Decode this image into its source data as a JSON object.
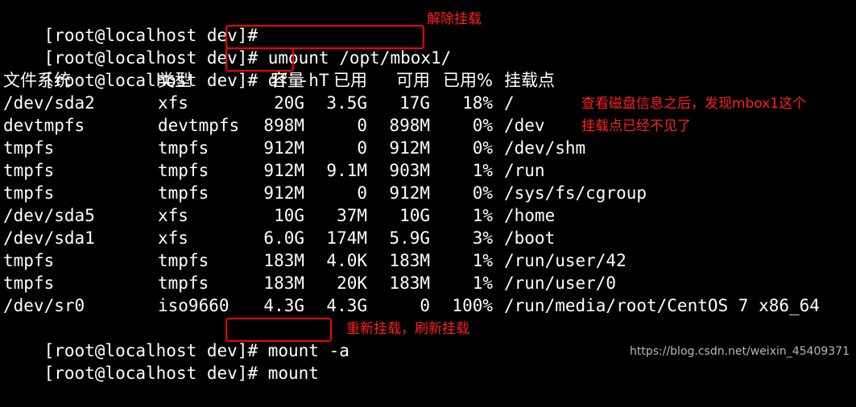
{
  "terminal": {
    "prompt_lines": [
      {
        "prompt": "[root@localhost dev]# ",
        "command": ""
      },
      {
        "prompt": "[root@localhost dev]# ",
        "command": "umount /opt/mbox1/"
      },
      {
        "prompt": "[root@localhost dev]# ",
        "command": "df -hT"
      }
    ],
    "df_header": {
      "filesystem": "文件系统",
      "type": "类型",
      "size": "容量",
      "used": "已用",
      "avail": "可用",
      "use_pct": "已用%",
      "mounted_on": "挂载点"
    },
    "df_rows": [
      {
        "filesystem": "/dev/sda2",
        "type": "xfs",
        "size": "20G",
        "used": "3.5G",
        "avail": "17G",
        "use_pct": "18%",
        "mounted_on": "/"
      },
      {
        "filesystem": "devtmpfs",
        "type": "devtmpfs",
        "size": "898M",
        "used": "0",
        "avail": "898M",
        "use_pct": "0%",
        "mounted_on": "/dev"
      },
      {
        "filesystem": "tmpfs",
        "type": "tmpfs",
        "size": "912M",
        "used": "0",
        "avail": "912M",
        "use_pct": "0%",
        "mounted_on": "/dev/shm"
      },
      {
        "filesystem": "tmpfs",
        "type": "tmpfs",
        "size": "912M",
        "used": "9.1M",
        "avail": "903M",
        "use_pct": "1%",
        "mounted_on": "/run"
      },
      {
        "filesystem": "tmpfs",
        "type": "tmpfs",
        "size": "912M",
        "used": "0",
        "avail": "912M",
        "use_pct": "0%",
        "mounted_on": "/sys/fs/cgroup"
      },
      {
        "filesystem": "/dev/sda5",
        "type": "xfs",
        "size": "10G",
        "used": "37M",
        "avail": "10G",
        "use_pct": "1%",
        "mounted_on": "/home"
      },
      {
        "filesystem": "/dev/sda1",
        "type": "xfs",
        "size": "6.0G",
        "used": "174M",
        "avail": "5.9G",
        "use_pct": "3%",
        "mounted_on": "/boot"
      },
      {
        "filesystem": "tmpfs",
        "type": "tmpfs",
        "size": "183M",
        "used": "4.0K",
        "avail": "183M",
        "use_pct": "1%",
        "mounted_on": "/run/user/42"
      },
      {
        "filesystem": "tmpfs",
        "type": "tmpfs",
        "size": "183M",
        "used": "20K",
        "avail": "183M",
        "use_pct": "1%",
        "mounted_on": "/run/user/0"
      },
      {
        "filesystem": "/dev/sr0",
        "type": "iso9660",
        "size": "4.3G",
        "used": "4.3G",
        "avail": "0",
        "use_pct": "100%",
        "mounted_on": "/run/media/root/CentOS 7 x86_64"
      }
    ],
    "after_lines": [
      {
        "prompt": "[root@localhost dev]# ",
        "command": "mount -a"
      },
      {
        "prompt": "[root@localhost dev]# ",
        "command": "mount"
      }
    ]
  },
  "annotations": {
    "umount_note": "解除挂载",
    "df_note_line1": "查看磁盘信息之后，发现mbox1这个",
    "df_note_line2": "挂载点已经不见了",
    "mount_note": "重新挂载，刷新挂载"
  },
  "watermark": "https://blog.csdn.net/weixin_45409371",
  "colors": {
    "background": "#000000",
    "text": "#ffffff",
    "annotation": "#ff0000"
  }
}
